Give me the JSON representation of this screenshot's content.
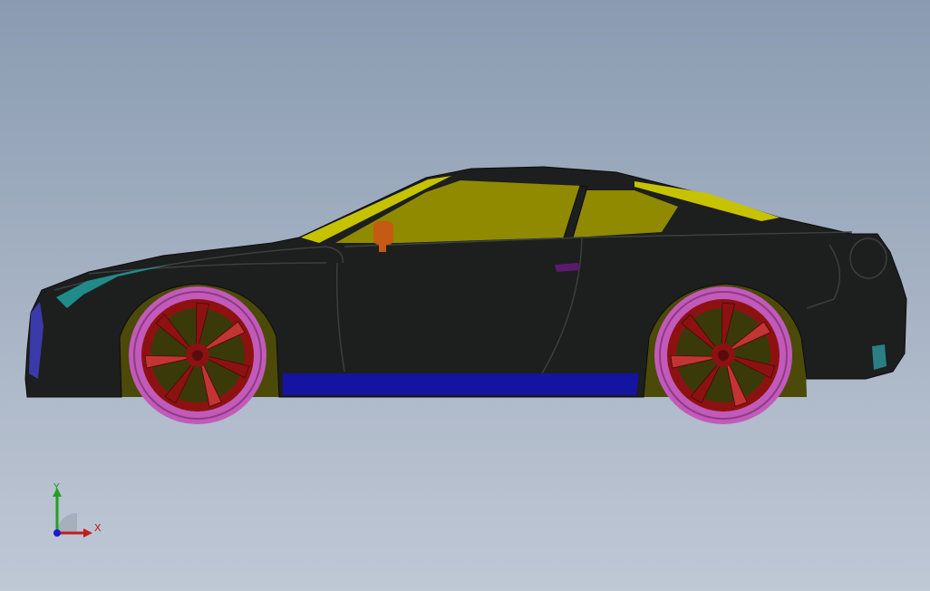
{
  "model": {
    "colors": {
      "body": "#1d1e1e",
      "body_edge": "#3c3f3f",
      "windows": "#8f8a00",
      "roof_stripe": "#c6c200",
      "side_skirt": "#1414a0",
      "tire": "#c25ab9",
      "rim": "#8c1212",
      "rim_highlight": "#c33434",
      "wheel_well": "#4b4a08",
      "headlight": "#1f8c8a",
      "front_grille": "#3a3aa8",
      "mirror": "#c65a12",
      "door_handle": "#5a1a6e",
      "rear_light": "#2a7f86"
    }
  },
  "triad": {
    "x_label": "X",
    "y_label": "Y",
    "x_color": "#c21c1c",
    "y_color": "#22a022",
    "origin_color": "#1a1ad0"
  }
}
